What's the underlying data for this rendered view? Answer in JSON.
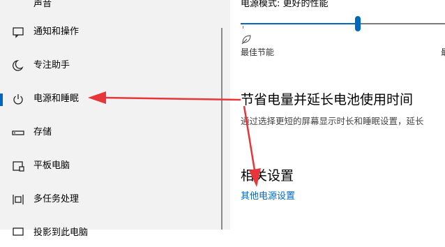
{
  "sidebar": {
    "items": [
      {
        "label": "声音",
        "icon": "speaker-icon"
      },
      {
        "label": "通知和操作",
        "icon": "notification-icon"
      },
      {
        "label": "专注助手",
        "icon": "moon-icon"
      },
      {
        "label": "电源和睡眠",
        "icon": "power-icon",
        "active": true
      },
      {
        "label": "存储",
        "icon": "storage-icon"
      },
      {
        "label": "平板电脑",
        "icon": "tablet-icon"
      },
      {
        "label": "多任务处理",
        "icon": "multitasking-icon"
      },
      {
        "label": "投影到此电脑",
        "icon": "projector-icon"
      }
    ]
  },
  "main": {
    "power_mode_label": "电源模式: 更好的性能",
    "power_slider": {
      "value_fraction": 0.56,
      "min_label": "最佳节能",
      "max_label_peek": "最"
    },
    "battery_section": {
      "title": "节省电量并延长电池使用时间",
      "description": "通过选择更短的屏幕显示时长和睡眠设置，延长"
    },
    "related_settings": {
      "title": "相关设置",
      "other_power_link": "其他电源设置"
    }
  },
  "colors": {
    "accent": "#0067c0",
    "annotation_arrow": "#e8353a",
    "sidebar_bg": "#f2f2f2"
  }
}
